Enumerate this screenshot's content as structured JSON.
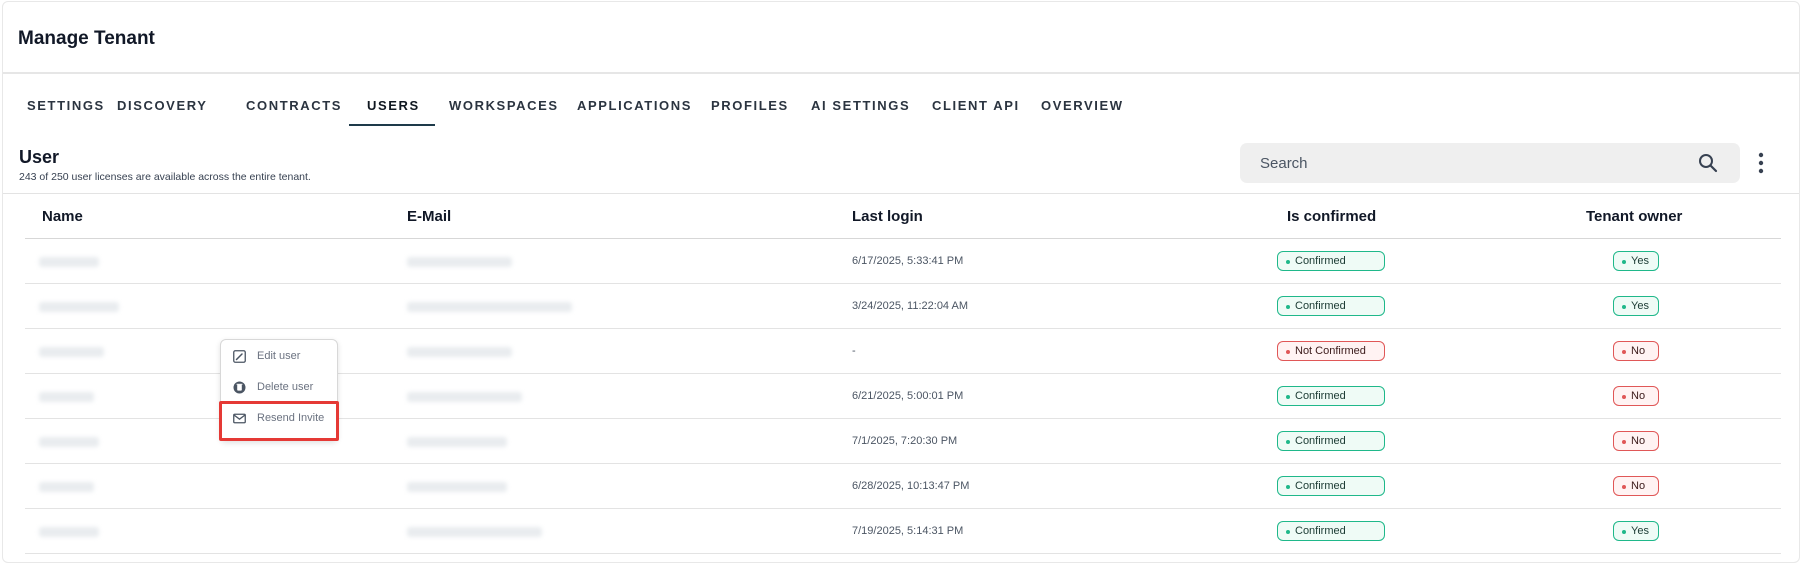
{
  "header": {
    "title": "Manage Tenant"
  },
  "tabs": [
    {
      "label": "SETTINGS",
      "active": false
    },
    {
      "label": "DISCOVERY",
      "active": false
    },
    {
      "label": "CONTRACTS",
      "active": false
    },
    {
      "label": "USERS",
      "active": true
    },
    {
      "label": "WORKSPACES",
      "active": false
    },
    {
      "label": "APPLICATIONS",
      "active": false
    },
    {
      "label": "PROFILES",
      "active": false
    },
    {
      "label": "AI SETTINGS",
      "active": false
    },
    {
      "label": "CLIENT API",
      "active": false
    },
    {
      "label": "OVERVIEW",
      "active": false
    }
  ],
  "section": {
    "title": "User",
    "subtitle": "243 of 250 user licenses are available across the entire tenant."
  },
  "search": {
    "placeholder": "Search",
    "icon": "search-icon"
  },
  "more_icon": "kebab-icon",
  "table": {
    "columns": [
      "Name",
      "E-Mail",
      "Last login",
      "Is confirmed",
      "Tenant owner"
    ],
    "rows": [
      {
        "last_login": "6/17/2025, 5:33:41 PM",
        "is_confirmed": "Confirmed",
        "tenant_owner": "Yes"
      },
      {
        "last_login": "3/24/2025, 11:22:04 AM",
        "is_confirmed": "Confirmed",
        "tenant_owner": "Yes"
      },
      {
        "last_login": "-",
        "is_confirmed": "Not Confirmed",
        "tenant_owner": "No"
      },
      {
        "last_login": "6/21/2025, 5:00:01 PM",
        "is_confirmed": "Confirmed",
        "tenant_owner": "No"
      },
      {
        "last_login": "7/1/2025, 7:20:30 PM",
        "is_confirmed": "Confirmed",
        "tenant_owner": "No"
      },
      {
        "last_login": "6/28/2025, 10:13:47 PM",
        "is_confirmed": "Confirmed",
        "tenant_owner": "No"
      },
      {
        "last_login": "7/19/2025, 5:14:31 PM",
        "is_confirmed": "Confirmed",
        "tenant_owner": "Yes"
      }
    ]
  },
  "context_menu": {
    "items": [
      {
        "label": "Edit user",
        "icon": "edit-icon"
      },
      {
        "label": "Delete user",
        "icon": "trash-icon"
      },
      {
        "label": "Resend Invite",
        "icon": "envelope-icon",
        "highlighted": true
      }
    ]
  },
  "colors": {
    "confirmed": "#1fb88a",
    "not_confirmed": "#e05757",
    "highlight": "#e53935",
    "tab_underline": "#1e3a4a"
  }
}
